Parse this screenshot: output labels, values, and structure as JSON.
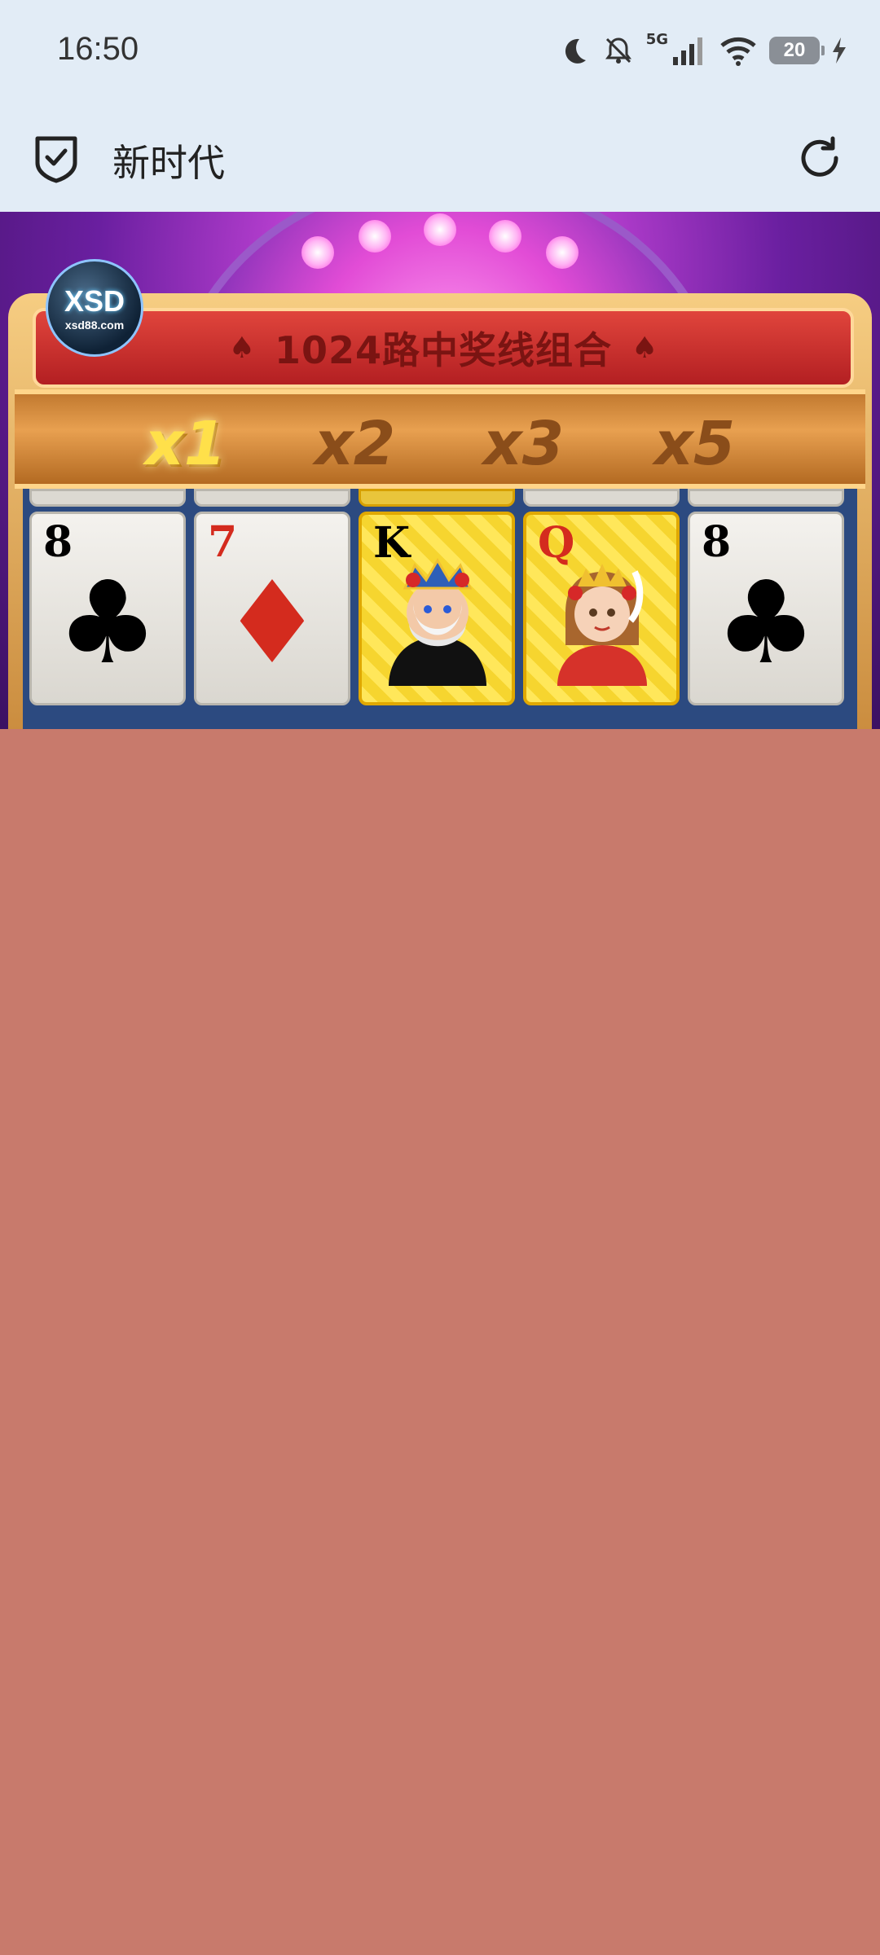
{
  "status_bar": {
    "time": "16:50",
    "network": "5G",
    "battery": "20",
    "icons": [
      "moon-icon",
      "bell-off-icon",
      "signal-icon",
      "wifi-icon",
      "battery-icon",
      "charging-icon"
    ]
  },
  "app_bar": {
    "title": "新时代",
    "left_icon": "shield-check-icon",
    "right_icon": "reload-icon"
  },
  "game": {
    "logo_main": "XSD",
    "logo_sub": "xsd88.com",
    "banner_text": "1024路中奖线组合",
    "multipliers": [
      {
        "label": "x1",
        "active": true
      },
      {
        "label": "x2",
        "active": false
      },
      {
        "label": "x3",
        "active": false
      },
      {
        "label": "x5",
        "active": false
      }
    ],
    "cards": [
      {
        "rank": "8",
        "suit": "♣",
        "color": "black",
        "style": "plain"
      },
      {
        "rank": "7",
        "suit": "♦",
        "color": "red",
        "style": "plain"
      },
      {
        "rank": "K",
        "suit": "♠",
        "color": "black",
        "style": "gold",
        "figure": "king"
      },
      {
        "rank": "Q",
        "suit": "♥",
        "color": "red",
        "style": "gold",
        "figure": "queen"
      },
      {
        "rank": "8",
        "suit": "♣",
        "color": "black",
        "style": "plain"
      }
    ]
  },
  "colors": {
    "status_bg": "#e2ecf6",
    "overlay": "#c87a6c",
    "banner": "#c92d28",
    "multiplier_active": "#ffe04a"
  }
}
